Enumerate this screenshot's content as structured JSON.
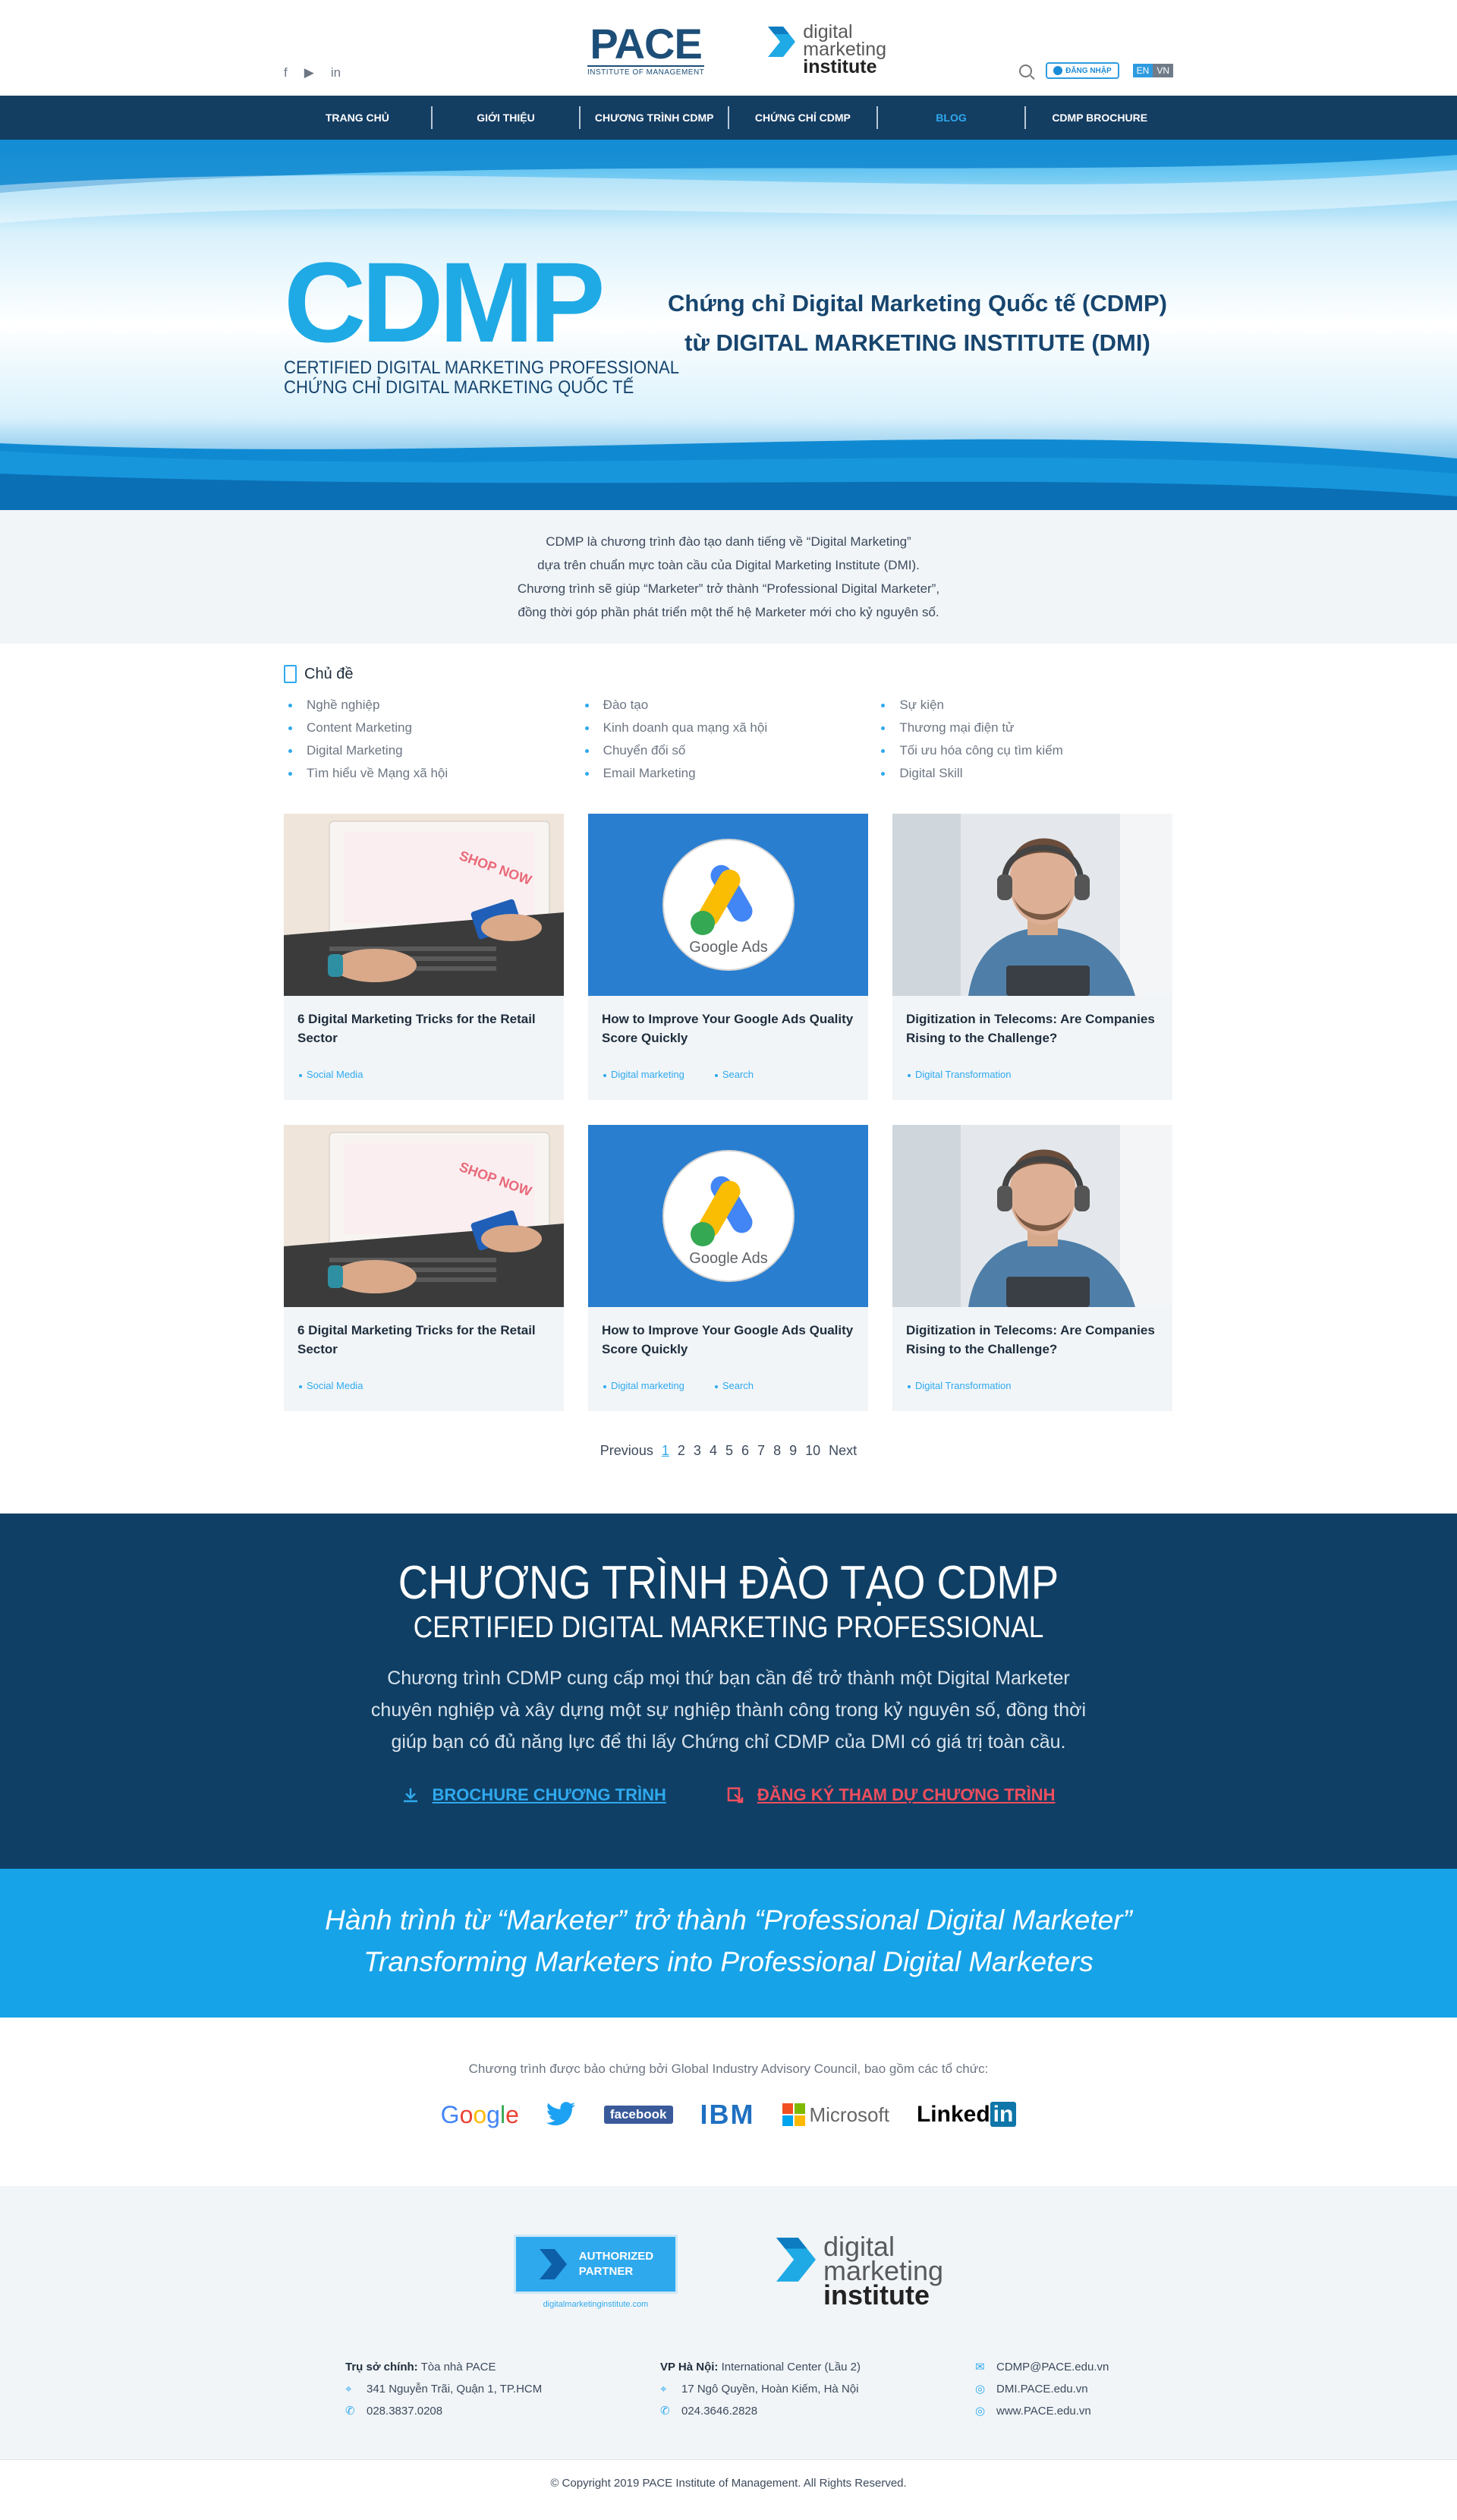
{
  "header": {
    "social": [
      "f",
      "▶",
      "in"
    ],
    "pace_name": "PACE",
    "pace_sub": "INSTITUTE OF MANAGEMENT",
    "dmi_line1": "digital",
    "dmi_line2": "marketing",
    "dmi_line3": "institute",
    "login_label": "ĐĂNG NHẬP",
    "lang_en": "EN",
    "lang_vn": "VN"
  },
  "nav": [
    {
      "label": "TRANG CHỦ"
    },
    {
      "label": "GIỚI THIỆU"
    },
    {
      "label": "CHƯƠNG TRÌNH CDMP"
    },
    {
      "label": "CHỨNG CHỈ CDMP"
    },
    {
      "label": "BLOG"
    },
    {
      "label": "CDMP BROCHURE"
    }
  ],
  "hero": {
    "logo_text": "CDMP",
    "logo_line1": "CERTIFIED DIGITAL MARKETING PROFESSIONAL",
    "logo_line2": "CHỨNG CHỈ DIGITAL MARKETING QUỐC TẾ",
    "title_line1": "Chứng chỉ Digital Marketing Quốc tế (CDMP)",
    "title_line2": "từ DIGITAL MARKETING INSTITUTE (DMI)"
  },
  "intro": {
    "line1": "CDMP là chương trình đào tạo danh tiếng về “Digital Marketing”",
    "line2": "dựa trên chuẩn mực toàn cầu của Digital Marketing Institute (DMI).",
    "line3": "Chương trình sẽ giúp “Marketer” trở thành “Professional Digital Marketer”,",
    "line4": "đồng thời góp phần phát triển một thế hệ Marketer mới cho kỷ nguyên số."
  },
  "topics": {
    "heading": "Chủ đề",
    "col1": [
      "Nghề nghiệp",
      "Content Marketing",
      "Digital Marketing",
      "Tìm hiểu về Mạng xã hội"
    ],
    "col2": [
      "Đào tạo",
      "Kinh doanh qua mạng xã hội",
      "Chuyển đổi số",
      "Email Marketing"
    ],
    "col3": [
      "Sự kiện",
      "Thương mại điện tử",
      "Tối ưu hóa công cụ tìm kiếm",
      "Digital Skill"
    ]
  },
  "posts": [
    {
      "title": "6 Digital Marketing Tricks for the Retail Sector",
      "tag1": "Social Media",
      "tag2": ""
    },
    {
      "title": "How to Improve Your Google Ads Quality Score Quickly",
      "tag1": "Digital marketing",
      "tag2": "Search"
    },
    {
      "title": "Digitization in Telecoms: Are Companies Rising to the Challenge?",
      "tag1": "Digital Transformation",
      "tag2": ""
    },
    {
      "title": "6 Digital Marketing Tricks for the Retail Sector",
      "tag1": "Social Media",
      "tag2": ""
    },
    {
      "title": "How to Improve Your Google Ads Quality Score Quickly",
      "tag1": "Digital marketing",
      "tag2": "Search"
    },
    {
      "title": "Digitization in Telecoms: Are Companies Rising to the Challenge?",
      "tag1": "Digital Transformation",
      "tag2": ""
    }
  ],
  "google_ads_label": "Google Ads",
  "shop_now_label": "SHOP NOW",
  "pager": {
    "prev": "Previous",
    "pages": [
      "1",
      "2",
      "3",
      "4",
      "5",
      "6",
      "7",
      "8",
      "9",
      "10"
    ],
    "next": "Next",
    "current": "1"
  },
  "program": {
    "title": "CHƯƠNG TRÌNH ĐÀO TẠO CDMP",
    "subtitle": "CERTIFIED DIGITAL MARKETING PROFESSIONAL",
    "desc1": "Chương trình CDMP cung cấp mọi thứ bạn cần để trở thành một Digital Marketer",
    "desc2": "chuyên nghiệp và xây dựng một sự nghiệp thành công trong kỷ nguyên số, đồng thời",
    "desc3": "giúp bạn có đủ năng lực để thi lấy Chứng chỉ CDMP của DMI có giá trị toàn cầu.",
    "brochure_link": "BROCHURE CHƯƠNG TRÌNH",
    "register_link": "ĐĂNG KÝ THAM DỰ CHƯƠNG TRÌNH"
  },
  "slogan": {
    "line1": "Hành trình từ “Marketer” trở thành “Professional Digital Marketer”",
    "line2": "Transforming Marketers into Professional Digital Marketers"
  },
  "partners": {
    "caption": "Chương trình được bảo chứng bởi Global Industry Advisory Council, bao gồm các tổ chức:",
    "google": "Google",
    "facebook": "facebook",
    "ibm": "IBM",
    "microsoft": "Microsoft",
    "linkedin": "Linked",
    "linkedin_in": "in"
  },
  "footer": {
    "badge_line1": "AUTHORIZED",
    "badge_line2": "PARTNER",
    "badge_url": "digitalmarketinginstitute.com",
    "hq_label": "Trụ sở chính:",
    "hq_name": "Tòa nhà PACE",
    "hq_address": "341 Nguyễn Trãi, Quận 1, TP.HCM",
    "hq_phone": "028.3837.0208",
    "hn_label": "VP Hà Nội:",
    "hn_name": "International Center (Lầu 2)",
    "hn_address": "17 Ngô Quyền, Hoàn Kiếm, Hà Nội",
    "hn_phone": "024.3646.2828",
    "email": "CDMP@PACE.edu.vn",
    "site1": "DMI.PACE.edu.vn",
    "site2": "www.PACE.edu.vn",
    "copyright": "© Copyright 2019 PACE Institute of Management. All Rights Reserved."
  },
  "colors": {
    "navy": "#143d62",
    "accent": "#2fa9ee",
    "cyan": "#17a3e8",
    "red": "#f04e5e"
  }
}
